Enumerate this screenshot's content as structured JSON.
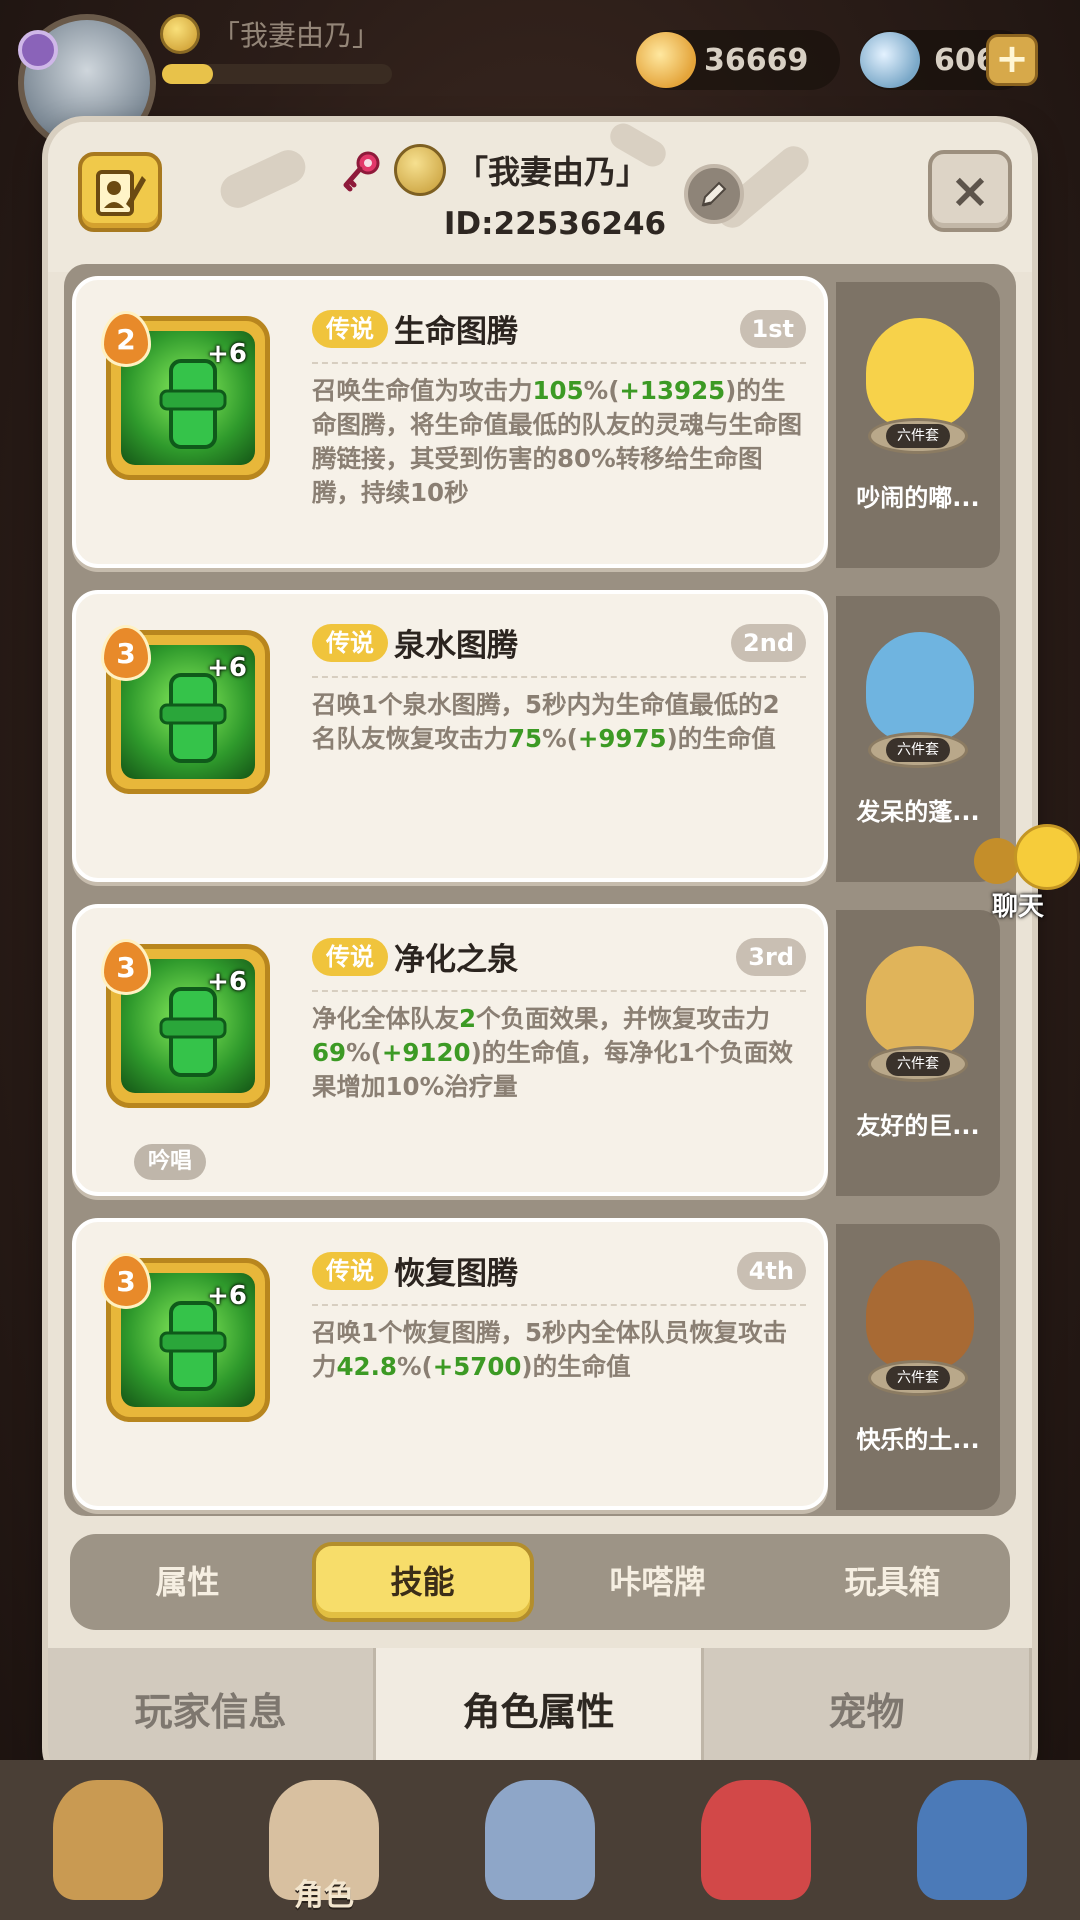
{
  "hud": {
    "player_name": "「我妻由乃」",
    "exp_fraction": 0.22,
    "gold_amount": "36669",
    "gem_amount": "606",
    "add_label": "+"
  },
  "dialog": {
    "player_name": "「我妻由乃」",
    "player_id": "ID:22536246",
    "close_label": "×"
  },
  "skills": [
    {
      "level": "2",
      "plus": "+6",
      "rarity": "传说",
      "name": "生命图腾",
      "rank": "1st",
      "desc_parts": [
        "召唤生命值为攻击力",
        "105",
        "%(",
        "+13925",
        ")的生命图腾，将生命值最低的队友的灵魂与生命图腾链接，其受到伤害的80%转移给生命图腾，持续10秒"
      ],
      "toy_name": "吵闹的嘟...",
      "toy_set": "六件套",
      "toy_color": "#f7d24a"
    },
    {
      "level": "3",
      "plus": "+6",
      "rarity": "传说",
      "name": "泉水图腾",
      "rank": "2nd",
      "desc_parts": [
        "召唤1个泉水图腾，5秒内为生命值最低的2名队友恢复攻击力",
        "75",
        "%(",
        "+9975",
        ")的生命值"
      ],
      "toy_name": "发呆的蓬...",
      "toy_set": "六件套",
      "toy_color": "#6fb4e0"
    },
    {
      "level": "3",
      "plus": "+6",
      "rarity": "传说",
      "name": "净化之泉",
      "rank": "3rd",
      "desc_parts": [
        "净化全体队友",
        "2",
        "个负面效果，并恢复攻击力",
        "69",
        "%(",
        "+9120",
        ")的生命值，每净化1个负面效果增加10%治疗量"
      ],
      "chant": "吟唱",
      "toy_name": "友好的巨...",
      "toy_set": "六件套",
      "toy_color": "#e0b45a"
    },
    {
      "level": "3",
      "plus": "+6",
      "rarity": "传说",
      "name": "恢复图腾",
      "rank": "4th",
      "desc_parts": [
        "召唤1个恢复图腾，5秒内全体队员恢复攻击力",
        "42.8",
        "%(",
        "+5700",
        ")的生命值"
      ],
      "toy_name": "快乐的土...",
      "toy_set": "六件套",
      "toy_color": "#a86a34"
    }
  ],
  "tabs": [
    "属性",
    "技能",
    "咔嗒牌",
    "玩具箱"
  ],
  "active_tab": "技能",
  "bottom_tabs": [
    "玩家信息",
    "角色属性",
    "宠物"
  ],
  "active_bottom_tab": "角色属性",
  "chat_label": "聊天",
  "nav": {
    "role_label": "角色"
  }
}
